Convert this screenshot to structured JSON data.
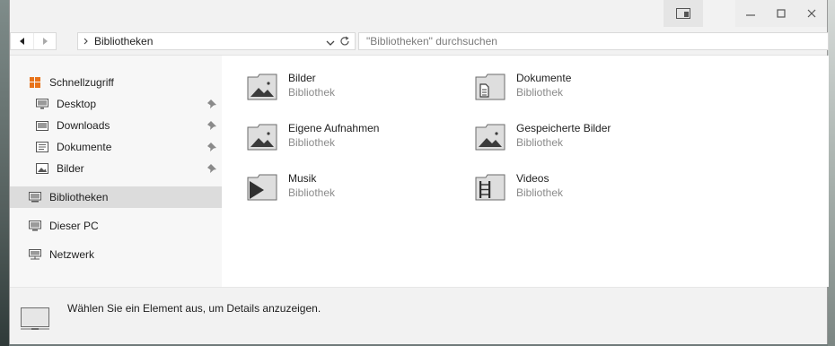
{
  "window": {
    "controls": {
      "aux_icon": "snap-layout-icon",
      "minimize_icon": "minimize-icon",
      "maximize_icon": "maximize-icon",
      "close_icon": "close-icon"
    }
  },
  "addressbar": {
    "back_icon": "back-arrow-icon",
    "forward_icon": "forward-arrow-icon",
    "breadcrumb": "Bibliotheken",
    "search_placeholder": "\"Bibliotheken\" durchsuchen"
  },
  "sidebar": {
    "quick_access": "Schnellzugriff",
    "pinned": [
      {
        "label": "Desktop",
        "icon": "desktop-icon"
      },
      {
        "label": "Downloads",
        "icon": "downloads-icon"
      },
      {
        "label": "Dokumente",
        "icon": "documents-icon"
      },
      {
        "label": "Bilder",
        "icon": "pictures-icon"
      }
    ],
    "libraries": "Bibliotheken",
    "this_pc": "Dieser PC",
    "network": "Netzwerk",
    "accent_color": "#e8731a"
  },
  "libraries": [
    {
      "name": "Bilder",
      "type": "Bibliothek",
      "icon": "pictures-library-icon"
    },
    {
      "name": "Dokumente",
      "type": "Bibliothek",
      "icon": "documents-library-icon"
    },
    {
      "name": "Eigene Aufnahmen",
      "type": "Bibliothek",
      "icon": "camera-roll-library-icon"
    },
    {
      "name": "Gespeicherte Bilder",
      "type": "Bibliothek",
      "icon": "saved-pictures-library-icon"
    },
    {
      "name": "Musik",
      "type": "Bibliothek",
      "icon": "music-library-icon"
    },
    {
      "name": "Videos",
      "type": "Bibliothek",
      "icon": "videos-library-icon"
    }
  ],
  "details": {
    "message": "Wählen Sie ein Element aus, um Details anzuzeigen."
  }
}
